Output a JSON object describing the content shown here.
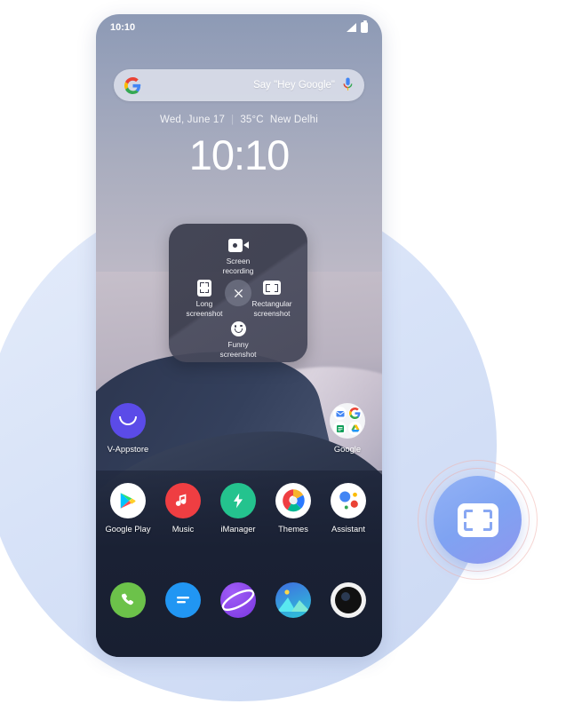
{
  "status_bar": {
    "time": "10:10",
    "signal_icon": "signal-bars-icon",
    "battery_icon": "battery-icon"
  },
  "search": {
    "google_icon": "google-g-icon",
    "hint": "Say \"Hey Google\"",
    "mic_icon": "microphone-icon"
  },
  "clock_widget": {
    "date": "Wed, June 17",
    "separator": "|",
    "temperature": "35°C",
    "city": "New Delhi",
    "time": "10:10"
  },
  "screenshot_panel": {
    "options": [
      {
        "id": "screen-recording",
        "label_line1": "Screen",
        "label_line2": "recording",
        "icon": "video-camera-icon"
      },
      {
        "id": "long-screenshot",
        "label_line1": "Long",
        "label_line2": "screenshot",
        "icon": "long-capture-frame-icon"
      },
      {
        "id": "rectangular-screenshot",
        "label_line1": "Rectangular",
        "label_line2": "screenshot",
        "icon": "rectangular-capture-frame-icon"
      },
      {
        "id": "funny-screenshot",
        "label_line1": "Funny",
        "label_line2": "screenshot",
        "icon": "smiley-face-icon"
      }
    ],
    "close_icon": "close-x-icon"
  },
  "home_screen": {
    "row_folders": [
      {
        "label": "V-Appstore",
        "icon": "v-appstore-icon"
      },
      {
        "label": "Google",
        "icon": "google-folder-icon"
      }
    ],
    "row_apps": [
      {
        "label": "Google Play",
        "icon": "google-play-icon"
      },
      {
        "label": "Music",
        "icon": "music-icon"
      },
      {
        "label": "iManager",
        "icon": "imanager-icon"
      },
      {
        "label": "Themes",
        "icon": "themes-icon"
      },
      {
        "label": "Assistant",
        "icon": "google-assistant-icon"
      }
    ],
    "dock": [
      {
        "name": "phone",
        "icon": "phone-icon"
      },
      {
        "name": "messages",
        "icon": "messages-icon"
      },
      {
        "name": "browser",
        "icon": "browser-planet-icon"
      },
      {
        "name": "gallery",
        "icon": "gallery-icon"
      },
      {
        "name": "camera",
        "icon": "camera-icon"
      }
    ]
  },
  "floating_button": {
    "icon": "screenshot-capture-icon",
    "accent_color": "#8aa8f3",
    "ring_color": "#f0b4af"
  }
}
